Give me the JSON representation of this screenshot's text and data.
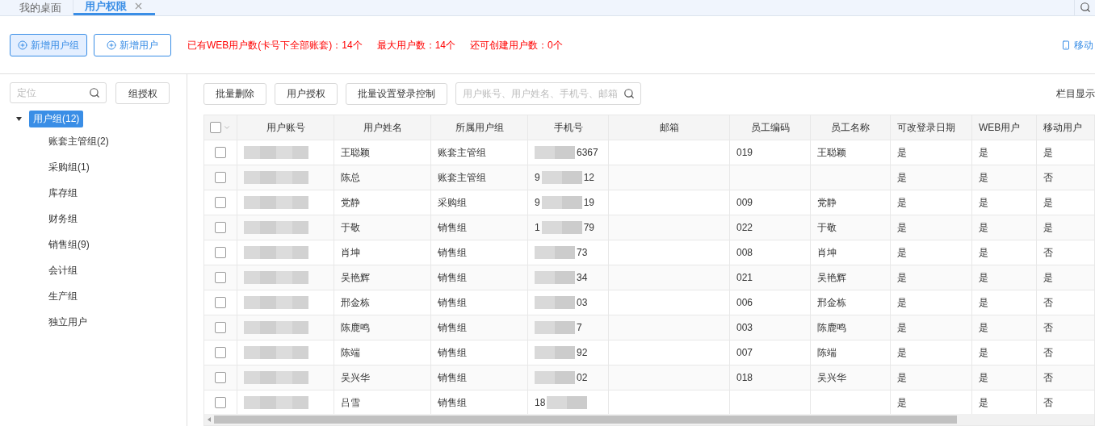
{
  "tabs": [
    {
      "label": "我的桌面",
      "selected": false,
      "closable": false
    },
    {
      "label": "用户权限",
      "selected": true,
      "closable": true
    }
  ],
  "toolbar": {
    "buttons": [
      {
        "label": "新增用户组",
        "selected": true
      },
      {
        "label": "新增用户",
        "selected": false
      }
    ],
    "stats": [
      "已有WEB用户数(卡号下全部账套)：14个",
      "最大用户数：14个",
      "还可创建用户数：0个"
    ],
    "mobile_link": "移动"
  },
  "sidebar": {
    "locate": {
      "placeholder": "定位"
    },
    "group_auth_button": "组授权",
    "tree": [
      {
        "label": "用户组(12)",
        "selected": true,
        "expanded": true,
        "children": [
          {
            "label": "账套主管组(2)",
            "selected": false
          },
          {
            "label": "采购组(1)",
            "selected": false
          },
          {
            "label": "库存组",
            "selected": false
          },
          {
            "label": "财务组",
            "selected": false
          },
          {
            "label": "销售组(9)",
            "selected": false
          },
          {
            "label": "会计组",
            "selected": false
          },
          {
            "label": "生产组",
            "selected": false
          },
          {
            "label": "独立用户",
            "selected": false
          }
        ]
      }
    ]
  },
  "actions": [
    "批量删除",
    "用户授权",
    "批量设置登录控制"
  ],
  "search": {
    "placeholder": "用户账号、用户姓名、手机号、邮箱"
  },
  "column_settings": "栏目显示",
  "table": {
    "select_all": {
      "checked": false
    },
    "columns": [
      "用户账号",
      "用户姓名",
      "所属用户组",
      "手机号",
      "邮箱",
      "员工编码",
      "员工名称",
      "可改登录日期",
      "WEB用户",
      "移动用户"
    ],
    "rows": [
      {
        "checked": false,
        "name": "王聪颖",
        "group": "账套主管组",
        "phone_prefix": "",
        "phone_suffix": "6367",
        "code": "019",
        "staff": "王聪颖",
        "date_editable": "是",
        "web": "是",
        "mobile": "是"
      },
      {
        "checked": false,
        "name": "陈总",
        "group": "账套主管组",
        "phone_prefix": "9",
        "phone_suffix": "12",
        "code": "",
        "staff": "",
        "date_editable": "是",
        "web": "是",
        "mobile": "否"
      },
      {
        "checked": false,
        "name": "党静",
        "group": "采购组",
        "phone_prefix": "9",
        "phone_suffix": "19",
        "code": "009",
        "staff": "党静",
        "date_editable": "是",
        "web": "是",
        "mobile": "是"
      },
      {
        "checked": false,
        "name": "于敬",
        "group": "销售组",
        "phone_prefix": "1",
        "phone_suffix": "79",
        "code": "022",
        "staff": "于敬",
        "date_editable": "是",
        "web": "是",
        "mobile": "是"
      },
      {
        "checked": false,
        "name": "肖坤",
        "group": "销售组",
        "phone_prefix": "",
        "phone_suffix": "73",
        "code": "008",
        "staff": "肖坤",
        "date_editable": "是",
        "web": "是",
        "mobile": "否"
      },
      {
        "checked": false,
        "name": "吴艳辉",
        "group": "销售组",
        "phone_prefix": "",
        "phone_suffix": "34",
        "code": "021",
        "staff": "吴艳辉",
        "date_editable": "是",
        "web": "是",
        "mobile": "是"
      },
      {
        "checked": false,
        "name": "邢金栋",
        "group": "销售组",
        "phone_prefix": "",
        "phone_suffix": "03",
        "code": "006",
        "staff": "邢金栋",
        "date_editable": "是",
        "web": "是",
        "mobile": "否"
      },
      {
        "checked": false,
        "name": "陈鹿鸣",
        "group": "销售组",
        "phone_prefix": "",
        "phone_suffix": "7",
        "code": "003",
        "staff": "陈鹿鸣",
        "date_editable": "是",
        "web": "是",
        "mobile": "否"
      },
      {
        "checked": false,
        "name": "陈端",
        "group": "销售组",
        "phone_prefix": "",
        "phone_suffix": "92",
        "code": "007",
        "staff": "陈端",
        "date_editable": "是",
        "web": "是",
        "mobile": "否"
      },
      {
        "checked": false,
        "name": "吴兴华",
        "group": "销售组",
        "phone_prefix": "",
        "phone_suffix": "02",
        "code": "018",
        "staff": "吴兴华",
        "date_editable": "是",
        "web": "是",
        "mobile": "否"
      },
      {
        "checked": false,
        "name": "吕雪",
        "group": "销售组",
        "phone_prefix": "18",
        "phone_suffix": "",
        "code": "",
        "staff": "",
        "date_editable": "是",
        "web": "是",
        "mobile": "否"
      }
    ]
  }
}
